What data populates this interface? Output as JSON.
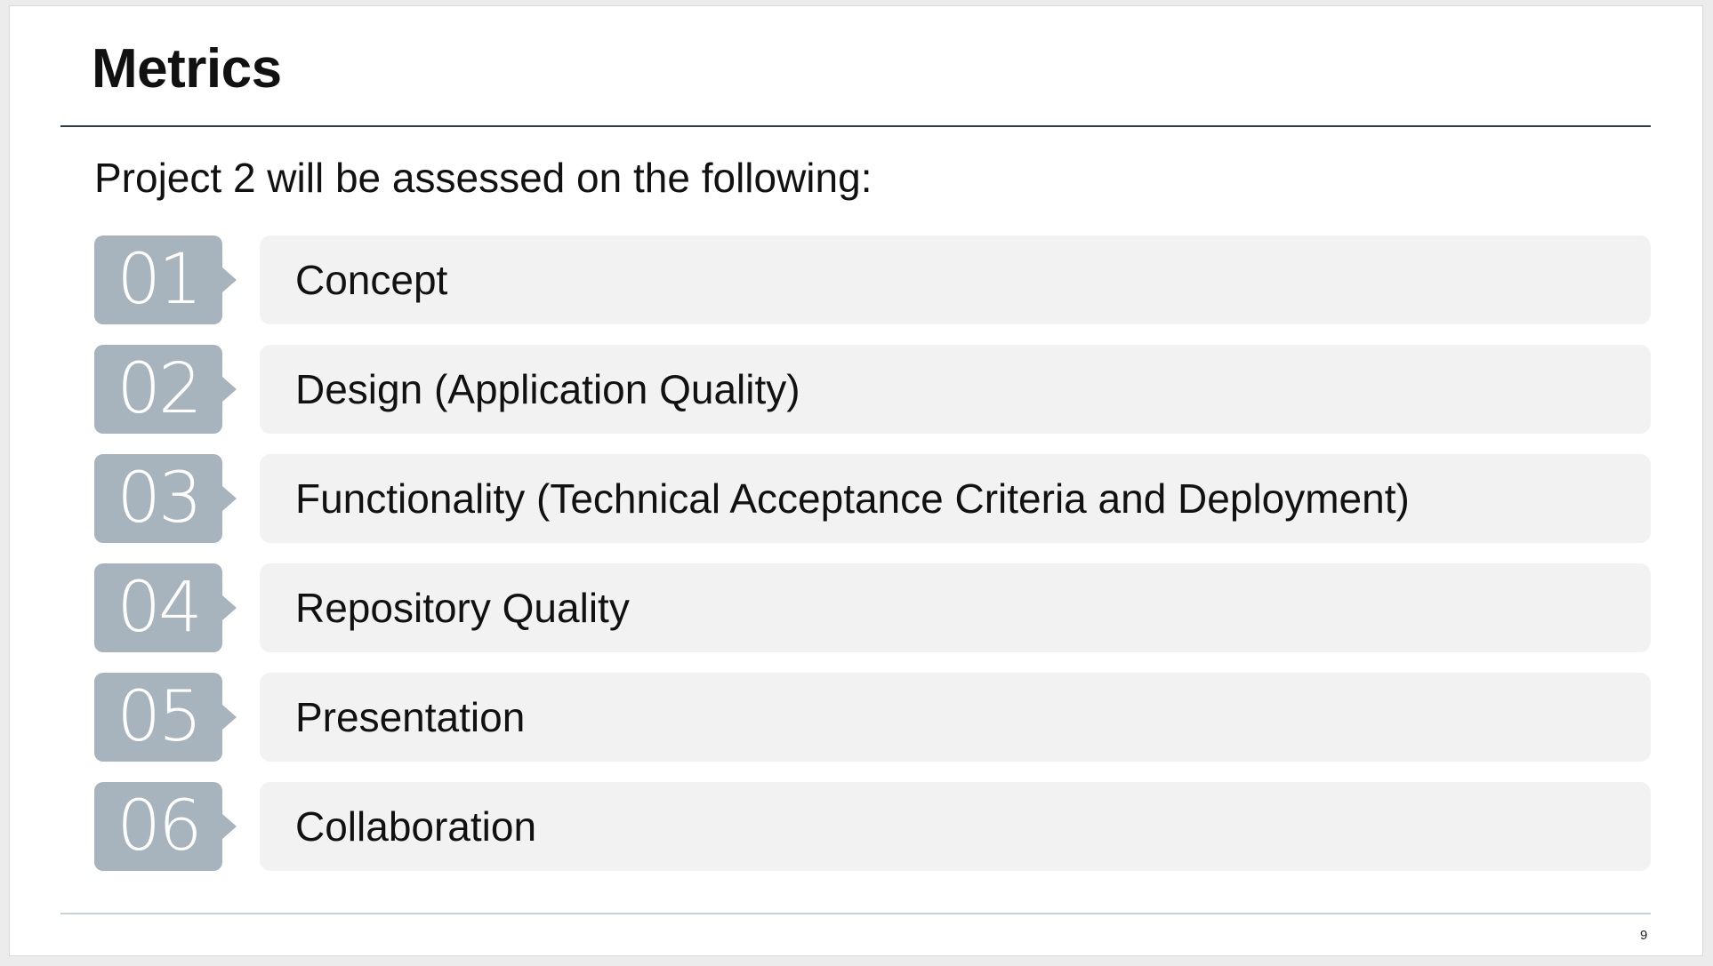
{
  "slide": {
    "title": "Metrics",
    "subtitle": "Project 2 will be assessed on the following:",
    "page_number": "9",
    "items": [
      {
        "number": "01",
        "label": "Concept"
      },
      {
        "number": "02",
        "label": "Design (Application Quality)"
      },
      {
        "number": "03",
        "label": "Functionality (Technical Acceptance Criteria and Deployment)"
      },
      {
        "number": "04",
        "label": "Repository Quality"
      },
      {
        "number": "05",
        "label": "Presentation"
      },
      {
        "number": "06",
        "label": "Collaboration"
      }
    ]
  },
  "colors": {
    "badge": "#a7b3bd",
    "bar": "#f2f2f2",
    "rule": "#2f3a44",
    "text": "#111111"
  }
}
